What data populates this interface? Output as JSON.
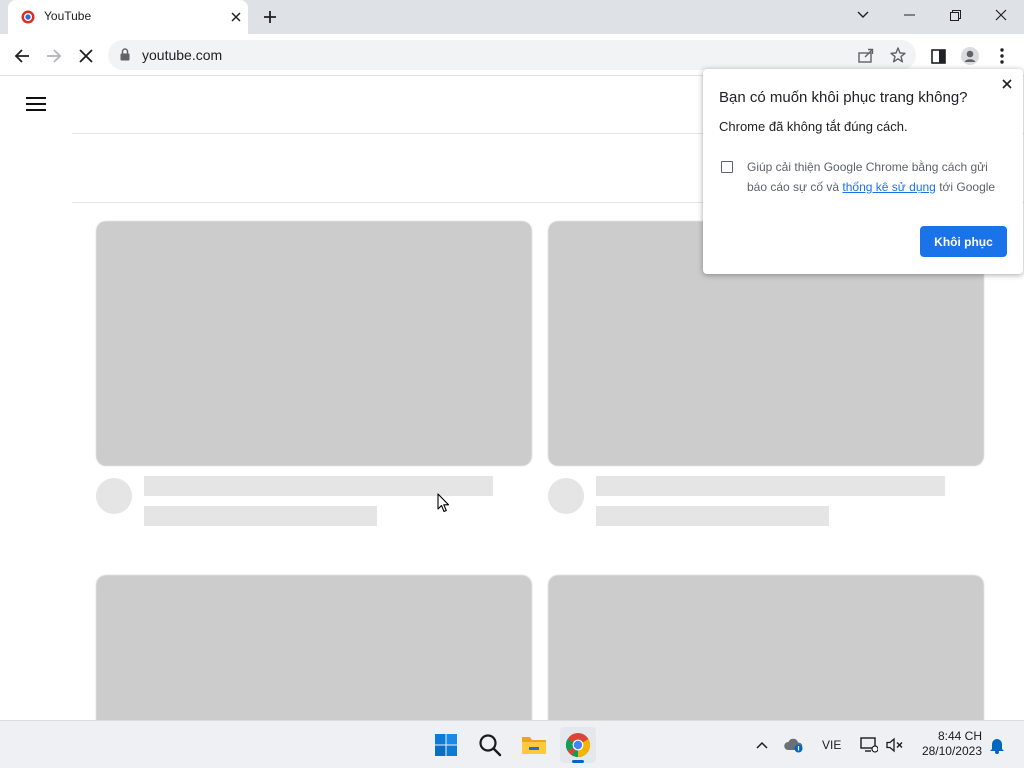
{
  "browser": {
    "tab_title": "YouTube",
    "url": "youtube.com"
  },
  "restore_popup": {
    "title": "Bạn có muốn khôi phục trang không?",
    "subtitle": "Chrome đã không tắt đúng cách.",
    "checkbox_text_before": "Giúp cải thiện Google Chrome bằng cách gửi báo cáo sự cố và ",
    "checkbox_link": "thống kê sử dụng",
    "checkbox_text_after": " tới Google",
    "checkbox_checked": false,
    "restore_button": "Khôi phục"
  },
  "taskbar": {
    "language": "VIE",
    "time": "8:44 CH",
    "date": "28/10/2023",
    "apps": [
      "windows-start",
      "search",
      "file-explorer",
      "google-chrome"
    ]
  },
  "colors": {
    "accent": "#1a73e8",
    "placeholder_thumb": "#cccccc",
    "placeholder_line": "#e5e5e5"
  }
}
